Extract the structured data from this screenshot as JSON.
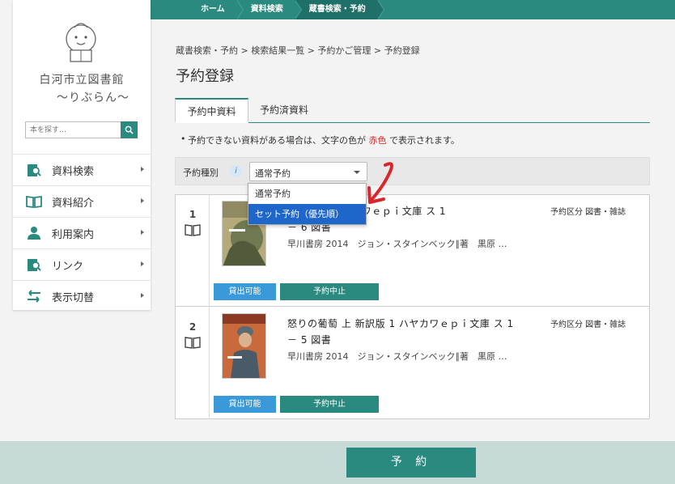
{
  "topnav": {
    "items": [
      "ホーム",
      "資料検索",
      "蔵書検索・予約"
    ]
  },
  "sidebar": {
    "library_name": "白河市立図書館",
    "library_sub": "～りぶらん～",
    "search_placeholder": "本を探す…",
    "items": [
      {
        "label": "資料検索",
        "icon": "book-search-icon"
      },
      {
        "label": "資料紹介",
        "icon": "open-book-icon"
      },
      {
        "label": "利用案内",
        "icon": "person-icon"
      },
      {
        "label": "リンク",
        "icon": "link-search-icon"
      },
      {
        "label": "表示切替",
        "icon": "swap-arrows-icon"
      }
    ]
  },
  "breadcrumb": "蔵書検索・予約 > 検索結果一覧 > 予約かご管理 > 予約登録",
  "page_title": "予約登録",
  "tabs": [
    "予約中資料",
    "予約済資料"
  ],
  "notice": {
    "before": "予約できない資料がある場合は、文字の色が",
    "red": "赤色",
    "after": "で表示されます。"
  },
  "filter": {
    "label": "予約種別",
    "selected": "通常予約",
    "options": [
      "通常予約",
      "セット予約（優先順）"
    ]
  },
  "results": [
    {
      "number": "1",
      "title_visible": "新訳版 3 ハヤカワｅｐｉ文庫 ス 1",
      "title_line2": "－ 6  図書",
      "category": "予約区分 図書・雑誌",
      "publisher": "早川書房 2014　ジョン・スタインベック∥著　黒原 …",
      "status": "貸出可能",
      "cancel": "予約中止"
    },
    {
      "number": "2",
      "title_line1": "怒りの葡萄 上 新訳版 1 ハヤカワｅｐｉ文庫 ス 1",
      "title_line2": "－ 5  図書",
      "category": "予約区分 図書・雑誌",
      "publisher": "早川書房 2014　ジョン・スタインベック∥著　黒原 …",
      "status": "貸出可能",
      "cancel": "予約中止"
    }
  ],
  "submit_label": "予 約",
  "colors": {
    "primary": "#2b8a80",
    "available": "#3a9ad9",
    "selected_option": "#1e66c9",
    "annotation": "#d9262c"
  }
}
